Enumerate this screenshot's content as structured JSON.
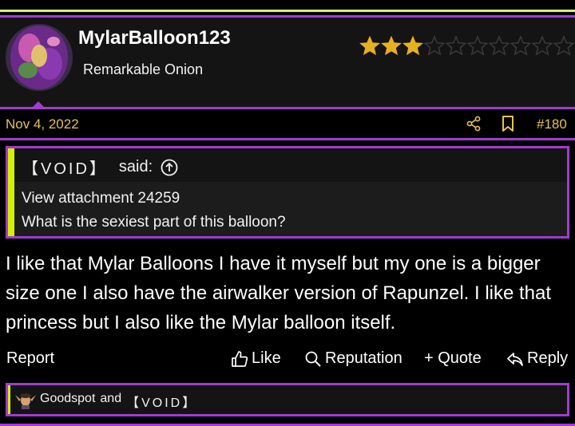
{
  "user": {
    "name": "MylarBalloon123",
    "title": "Remarkable Onion",
    "rating_filled": 3,
    "rating_total": 10
  },
  "post": {
    "date": "Nov 4, 2022",
    "number": "#180",
    "text": "I like that Mylar Balloons I have it myself but my one is a bigger size one I also have the airwalker version of Rapunzel. I like that princess but I also like the Mylar balloon itself."
  },
  "quote": {
    "author": "【VOID】",
    "said": "said:",
    "lines": [
      "View attachment 24259",
      "What is the sexiest part of this balloon?"
    ]
  },
  "actions": {
    "report": "Report",
    "like": "Like",
    "reputation": "Reputation",
    "quote": "+ Quote",
    "reply": "Reply"
  },
  "reactions": {
    "user1": "Goodspot",
    "joiner": "and",
    "user2": "【VOID】"
  },
  "colors": {
    "accent_purple": "#a23bd0",
    "accent_lime": "#d3f000",
    "date_gold": "#e7c250",
    "star_gold": "#e8b020"
  },
  "icons": [
    "share-icon",
    "bookmark-icon",
    "arrow-up-circle-icon",
    "thumbs-up-icon",
    "search-icon",
    "reply-icon",
    "star-icon"
  ]
}
